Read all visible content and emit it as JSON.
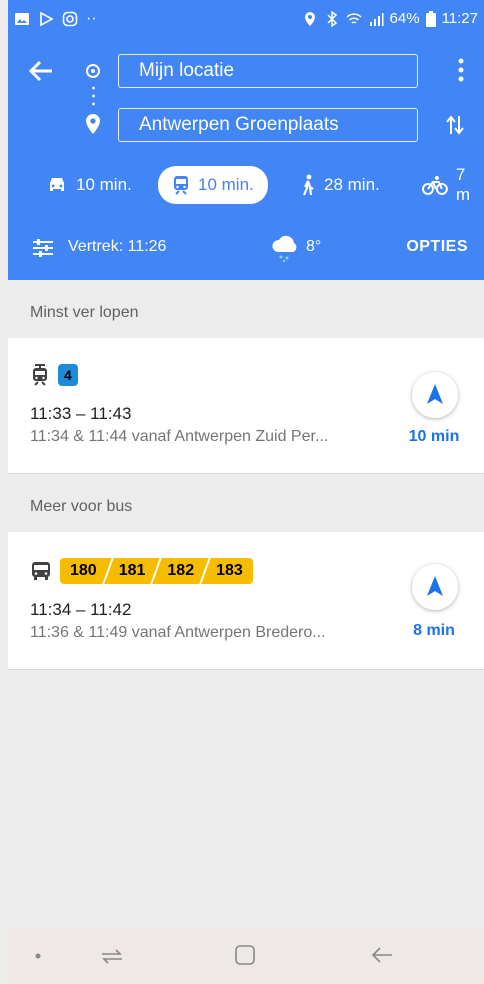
{
  "status_bar": {
    "battery": "64%",
    "time": "11:27",
    "icons": [
      "gallery-icon",
      "play-store-icon",
      "instagram-icon",
      "more-notifications-icon",
      "location-icon",
      "bluetooth-icon",
      "wifi-icon",
      "signal-icon",
      "battery-icon"
    ]
  },
  "route": {
    "origin": "Mijn locatie",
    "destination": "Antwerpen Groenplaats"
  },
  "modes": [
    {
      "name": "car",
      "icon": "car-icon",
      "label": "10 min."
    },
    {
      "name": "transit",
      "icon": "train-icon",
      "label": "10 min.",
      "active": true
    },
    {
      "name": "walk",
      "icon": "walk-icon",
      "label": "28 min."
    },
    {
      "name": "bike",
      "icon": "bike-icon",
      "label": "7 m"
    }
  ],
  "options_bar": {
    "departure": "Vertrek: 11:26",
    "temperature": "8°",
    "options_label": "OPTIES"
  },
  "sections": [
    {
      "title": "Minst ver lopen",
      "result": {
        "vehicle_icon": "tram-icon",
        "lines": [
          "4"
        ],
        "times": "11:33 – 11:43",
        "details": "11:34 & 11:44 vanaf Antwerpen Zuid Per...",
        "duration": "10 min"
      }
    },
    {
      "title": "Meer voor bus",
      "result": {
        "vehicle_icon": "bus-icon",
        "lines": [
          "180",
          "181",
          "182",
          "183"
        ],
        "times": "11:34 – 11:42",
        "details": "11:36 & 11:49 vanaf Antwerpen Bredero...",
        "duration": "8 min"
      }
    }
  ],
  "colors": {
    "primary": "#4285f4",
    "tram_badge": "#1a8cd8",
    "bus_badge": "#f6bd00",
    "link": "#1a73e8"
  }
}
